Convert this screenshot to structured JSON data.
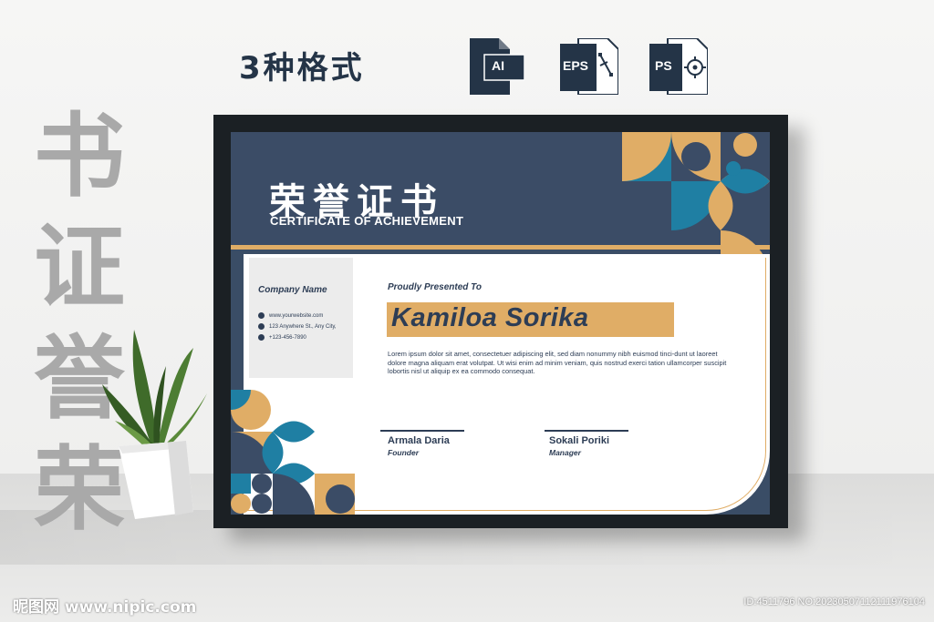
{
  "wall_text": [
    "书",
    "证",
    "誉",
    "荣"
  ],
  "formats": {
    "title": "3种格式",
    "icons": [
      {
        "label": "AI",
        "icon": "ai-file-icon"
      },
      {
        "label": "EPS",
        "icon": "eps-file-icon"
      },
      {
        "label": "PS",
        "icon": "ps-file-icon"
      }
    ]
  },
  "certificate": {
    "title_zh": "荣誉证书",
    "title_en": "CERTIFICATE OF ACHIEVEMENT",
    "company_name": "Company Name",
    "contacts": [
      {
        "icon": "globe-icon",
        "text": "www.yourwebsite.com"
      },
      {
        "icon": "location-icon",
        "text": "123 Anywhere St., Any City,"
      },
      {
        "icon": "phone-icon",
        "text": "+123-456-7890"
      }
    ],
    "presented_label": "Proudly Presented To",
    "recipient": "Kamiloa Sorika",
    "body": "Lorem ipsum dolor sit amet, consectetuer adipiscing elit, sed diam nonummy nibh euismod tinci-dunt ut laoreet dolore magna aliquam erat volutpat. Ut wisi enim ad minim veniam, quis nostrud exerci tation ullamcorper suscipit lobortis nisl ut aliquip ex ea commodo consequat.",
    "signatures": [
      {
        "name": "Armala Daria",
        "role": "Founder"
      },
      {
        "name": "Sokali Poriki",
        "role": "Manager"
      }
    ]
  },
  "footer": {
    "logo": "昵图网 www.nipic.com",
    "id_text": "ID:4511796 NO:20230507112111976104"
  },
  "colors": {
    "navy": "#3b4c66",
    "gold": "#e0ad66",
    "teal": "#1f7fa3",
    "frame": "#1b2024"
  }
}
